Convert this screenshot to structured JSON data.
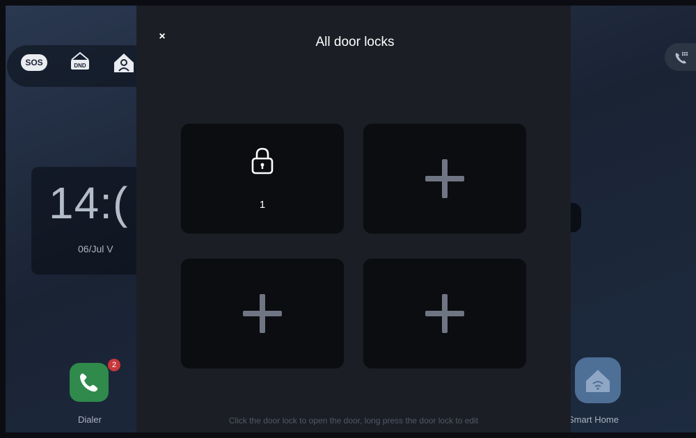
{
  "background": {
    "sos_label": "SOS",
    "dnd_label": "DND",
    "clock_time": "14:(",
    "clock_date": "06/Jul V",
    "dialer_label": "Dialer",
    "dialer_badge": "2",
    "smart_home_label": "Smart Home"
  },
  "modal": {
    "close_label": "×",
    "title": "All door locks",
    "tiles": [
      {
        "type": "lock",
        "label": "1"
      },
      {
        "type": "add"
      },
      {
        "type": "add"
      },
      {
        "type": "add"
      }
    ],
    "hint": "Click the door lock to open the door, long press the door lock to edit"
  },
  "colors": {
    "modal_bg": "#1b1e25",
    "tile_bg": "#0b0d11",
    "plus": "#6f7582",
    "text": "#ffffff",
    "hint": "#525866"
  },
  "icons": [
    "lock-icon",
    "plus-icon",
    "close-icon",
    "sos-icon",
    "dnd-icon",
    "home-contact-icon",
    "phone-icon",
    "smart-home-icon"
  ]
}
